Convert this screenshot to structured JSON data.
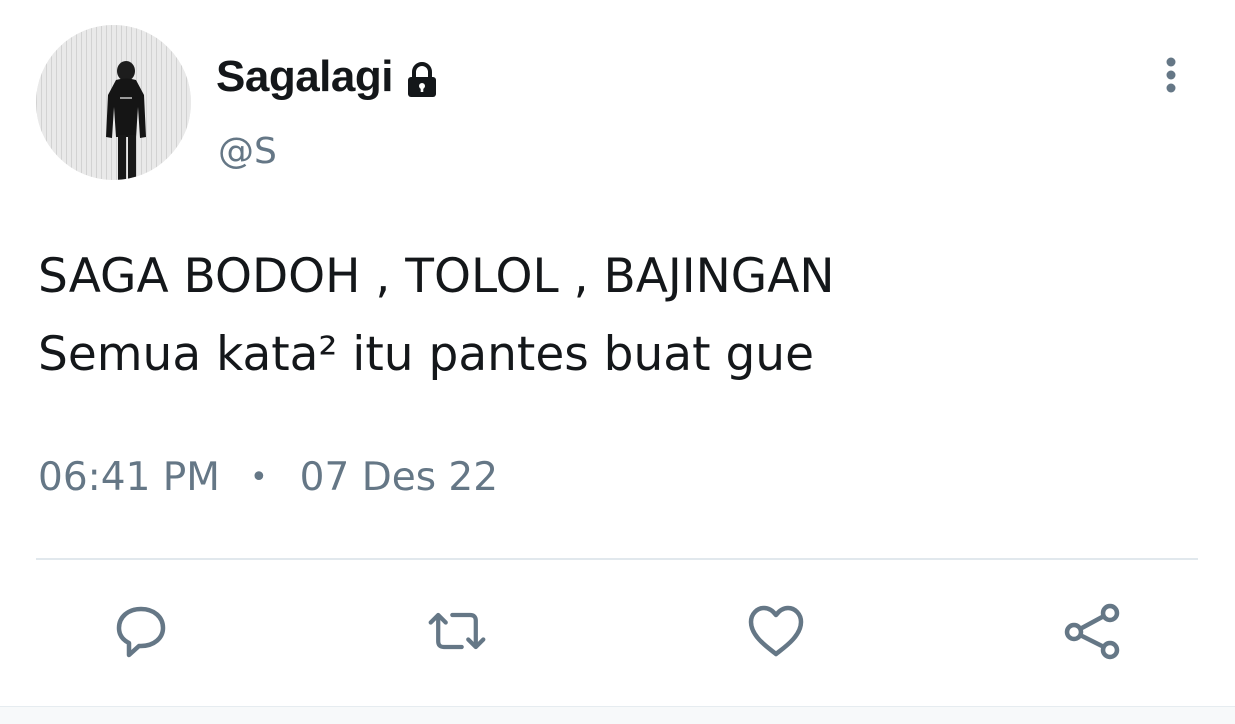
{
  "tweet": {
    "display_name": "Sagalagi",
    "handle": "@S",
    "protected_icon": "lock-icon",
    "text_lines": [
      "SAGA BODOH , TOLOL , BAJINGAN",
      "Semua kata² itu pantes buat gue"
    ],
    "time": "06:41 PM",
    "separator": "•",
    "date": "07 Des 22"
  },
  "actions": {
    "reply_icon": "comment-icon",
    "retweet_icon": "retweet-icon",
    "like_icon": "heart-icon",
    "share_icon": "share-icon",
    "more_icon": "more-vertical-icon"
  },
  "colors": {
    "text": "#14171a",
    "secondary": "#657786",
    "divider": "#e1e8ed"
  }
}
